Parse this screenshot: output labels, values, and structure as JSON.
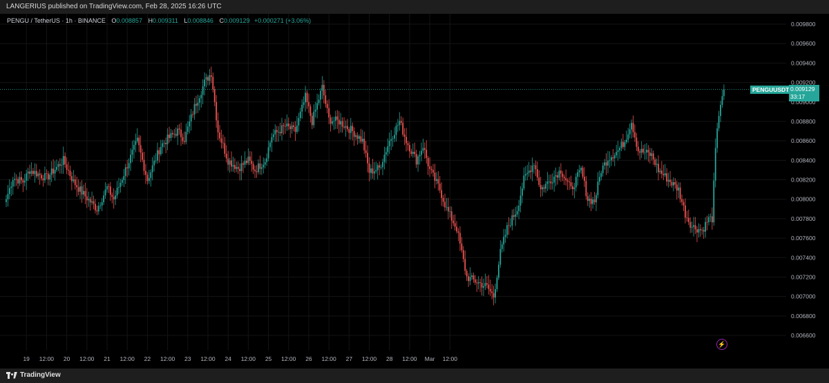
{
  "header": {
    "publisher": "LANGERIUS published on TradingView.com, Feb 28, 2025 16:26 UTC"
  },
  "legend": {
    "symbol": "PENGU / TetherUS · 1h · BINANCE",
    "o_label": "O",
    "o_value": "0.008857",
    "h_label": "H",
    "h_value": "0.009311",
    "l_label": "L",
    "l_value": "0.008846",
    "c_label": "C",
    "c_value": "0.009129",
    "change": "+0.000271 (+3.06%)"
  },
  "price_tag": {
    "label": "PENGUUSDT",
    "price": "0.009129",
    "countdown": "33:17"
  },
  "footer": {
    "brand": "TradingView"
  },
  "colors": {
    "up": "#26a69a",
    "down": "#ef5350",
    "background": "#000000",
    "grid": "#141414",
    "accent": "#26a69a"
  },
  "icons": {
    "alert": "flash-icon",
    "logo": "tradingview-logo-icon"
  },
  "chart_data": {
    "type": "candlestick",
    "title": "PENGU / TetherUS · 1h · BINANCE",
    "xlabel": "",
    "ylabel": "",
    "ylim": [
      0.0065,
      0.0099
    ],
    "y_tick_labels": [
      "0.009800",
      "0.009600",
      "0.009400",
      "0.009200",
      "0.009000",
      "0.008800",
      "0.008600",
      "0.008400",
      "0.008200",
      "0.008000",
      "0.007800",
      "0.007600",
      "0.007400",
      "0.007200",
      "0.007000",
      "0.006800",
      "0.006600"
    ],
    "x_tick_labels": [
      "19",
      "12:00",
      "20",
      "12:00",
      "21",
      "12:00",
      "22",
      "12:00",
      "23",
      "12:00",
      "24",
      "12:00",
      "25",
      "12:00",
      "26",
      "12:00",
      "27",
      "12:00",
      "28",
      "12:00",
      "Mar",
      "12:00"
    ],
    "grid": true,
    "last_price": 0.009129,
    "series": [
      {
        "name": "PENGUUSDT",
        "anchors": [
          [
            0,
            0.008
          ],
          [
            4,
            0.00822
          ],
          [
            10,
            0.00818
          ],
          [
            14,
            0.0083
          ],
          [
            20,
            0.00825
          ],
          [
            24,
            0.00822
          ],
          [
            34,
            0.0084
          ],
          [
            40,
            0.00818
          ],
          [
            46,
            0.00805
          ],
          [
            54,
            0.0079
          ],
          [
            60,
            0.00812
          ],
          [
            64,
            0.008
          ],
          [
            72,
            0.00835
          ],
          [
            78,
            0.0086
          ],
          [
            84,
            0.0082
          ],
          [
            92,
            0.00855
          ],
          [
            96,
            0.00862
          ],
          [
            102,
            0.0087
          ],
          [
            106,
            0.00862
          ],
          [
            112,
            0.00895
          ],
          [
            118,
            0.0092
          ],
          [
            122,
            0.0093
          ],
          [
            126,
            0.0087
          ],
          [
            132,
            0.0084
          ],
          [
            138,
            0.00832
          ],
          [
            144,
            0.0084
          ],
          [
            148,
            0.0083
          ],
          [
            154,
            0.0084
          ],
          [
            158,
            0.00865
          ],
          [
            166,
            0.00875
          ],
          [
            172,
            0.0087
          ],
          [
            178,
            0.00905
          ],
          [
            182,
            0.0088
          ],
          [
            188,
            0.00915
          ],
          [
            192,
            0.00882
          ],
          [
            198,
            0.0088
          ],
          [
            206,
            0.0087
          ],
          [
            212,
            0.0086
          ],
          [
            216,
            0.00828
          ],
          [
            222,
            0.00832
          ],
          [
            228,
            0.0086
          ],
          [
            234,
            0.0088
          ],
          [
            238,
            0.0086
          ],
          [
            244,
            0.0084
          ],
          [
            248,
            0.00855
          ],
          [
            252,
            0.0083
          ],
          [
            258,
            0.0081
          ],
          [
            262,
            0.0079
          ],
          [
            268,
            0.0077
          ],
          [
            274,
            0.0072
          ],
          [
            280,
            0.00715
          ],
          [
            286,
            0.0071
          ],
          [
            290,
            0.007
          ],
          [
            294,
            0.00745
          ],
          [
            298,
            0.0077
          ],
          [
            304,
            0.0079
          ],
          [
            308,
            0.0082
          ],
          [
            314,
            0.00838
          ],
          [
            318,
            0.0081
          ],
          [
            324,
            0.0082
          ],
          [
            330,
            0.0083
          ],
          [
            336,
            0.0081
          ],
          [
            342,
            0.0083
          ],
          [
            346,
            0.008
          ],
          [
            350,
            0.00798
          ],
          [
            354,
            0.0083
          ],
          [
            358,
            0.00842
          ],
          [
            364,
            0.0085
          ],
          [
            368,
            0.0086
          ],
          [
            372,
            0.0088
          ],
          [
            376,
            0.0085
          ],
          [
            380,
            0.00848
          ],
          [
            384,
            0.00845
          ],
          [
            388,
            0.0083
          ],
          [
            394,
            0.0082
          ],
          [
            400,
            0.0081
          ],
          [
            404,
            0.00785
          ],
          [
            408,
            0.00772
          ],
          [
            414,
            0.00768
          ],
          [
            418,
            0.0078
          ],
          [
            420,
            0.0078
          ],
          [
            422,
            0.0085
          ],
          [
            424,
            0.00888
          ],
          [
            426,
            0.00906
          ],
          [
            427,
            0.00913
          ]
        ]
      }
    ]
  }
}
